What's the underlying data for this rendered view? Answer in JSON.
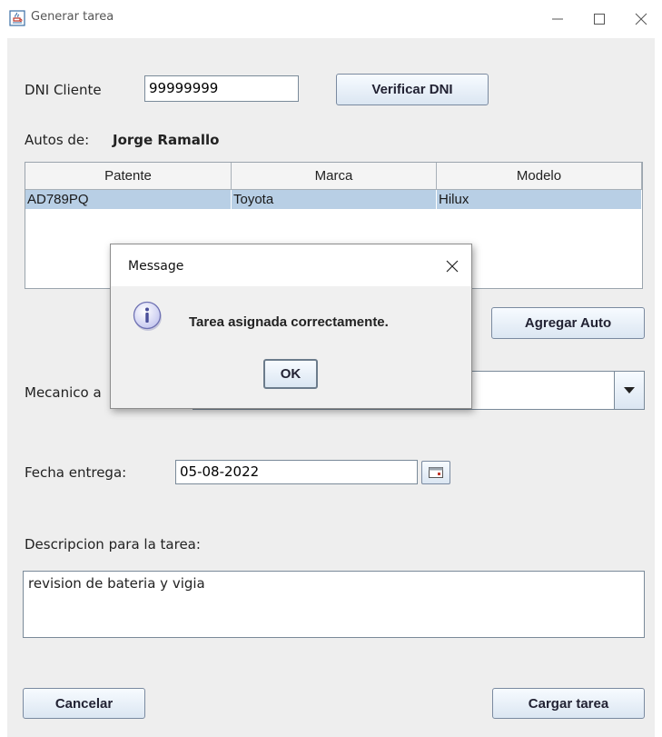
{
  "window": {
    "title": "Generar tarea",
    "icon": "java-cup-icon"
  },
  "form": {
    "dni_label": "DNI Cliente",
    "dni_value": "99999999",
    "verify_button": "Verificar DNI",
    "autos_label": "Autos de:",
    "client_name": "Jorge Ramallo",
    "add_car_button": "Agregar Auto",
    "mechanic_label": "Mecanico a",
    "date_label": "Fecha entrega:",
    "date_value": "05-08-2022",
    "desc_label": "Descripcion para la tarea:",
    "desc_value": "revision de bateria y vigia",
    "cancel_button": "Cancelar",
    "submit_button": "Cargar tarea"
  },
  "table": {
    "columns": [
      "Patente",
      "Marca",
      "Modelo"
    ],
    "rows": [
      [
        "AD789PQ",
        "Toyota",
        "Hilux"
      ]
    ]
  },
  "dialog": {
    "title": "Message",
    "message": "Tarea asignada correctamente.",
    "ok_button": "OK",
    "icon": "info-icon"
  },
  "colors": {
    "selected_row": "#b8cfe5",
    "panel_bg": "#eeeeee"
  }
}
